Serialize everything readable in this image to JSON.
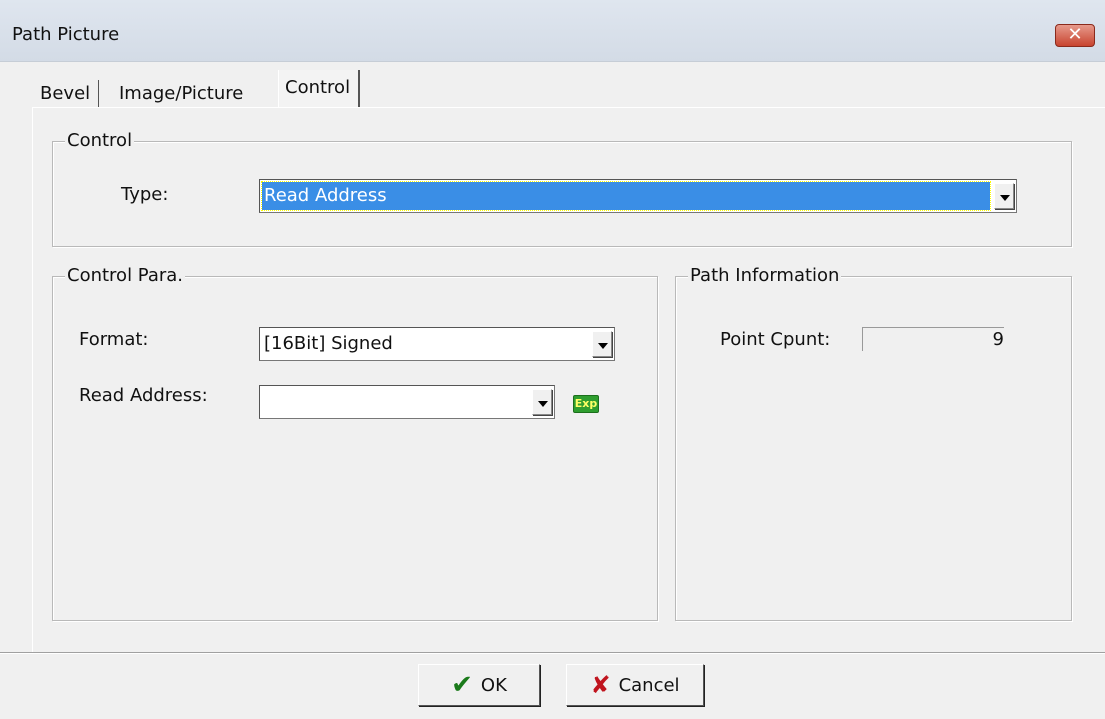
{
  "window": {
    "title": "Path Picture",
    "close_icon": "close-icon"
  },
  "tabs": [
    {
      "label": "Bevel"
    },
    {
      "label": "Image/Picture"
    },
    {
      "label": "Control",
      "active": true
    }
  ],
  "control_group": {
    "title": "Control",
    "type_label": "Type:",
    "type_value": "Read Address"
  },
  "control_para": {
    "title": "Control Para.",
    "format_label": "Format:",
    "format_value": "[16Bit] Signed",
    "read_address_label": "Read Address:",
    "read_address_value": "",
    "exp_icon_text": "Exp"
  },
  "path_info": {
    "title": "Path Information",
    "point_count_label": "Point Cpunt:",
    "point_count_value": "9"
  },
  "footer": {
    "ok_label": "OK",
    "cancel_label": "Cancel"
  },
  "colors": {
    "selection": "#3a8ee6",
    "close_button": "#c8442f",
    "ok_check": "#1a7a1a",
    "cancel_x": "#c0141e",
    "exp_icon": "#2f9e2f"
  }
}
